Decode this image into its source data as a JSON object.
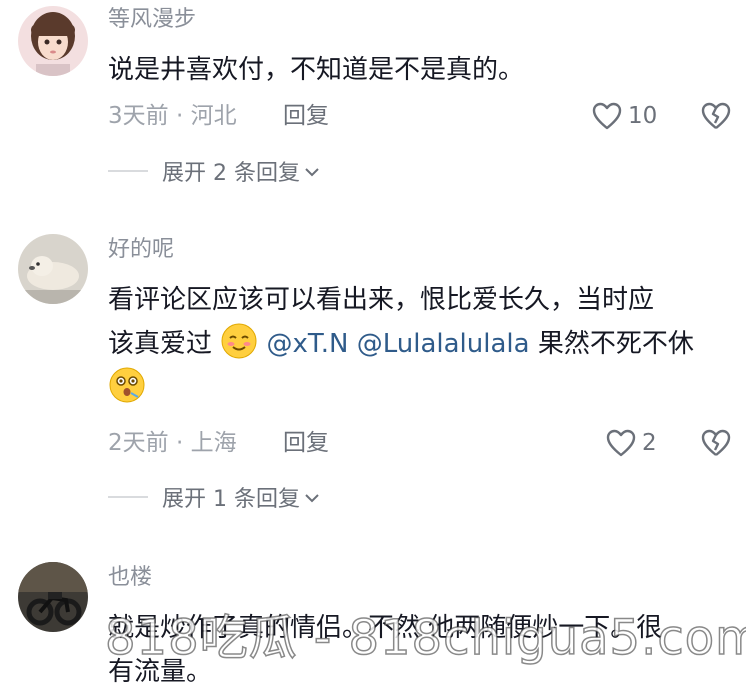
{
  "comments": [
    {
      "username": "等风漫步",
      "text": "说是井喜欢付，不知道是不是真的。",
      "time": "3天前 · 河北",
      "reply_label": "回复",
      "likes": "10",
      "expand_label": "展开 2 条回复"
    },
    {
      "username": "好的呢",
      "text_line1": "看评论区应该可以看出来，恨比爱长久，当时应",
      "text_line2_prefix": "该真爱过",
      "mention1": "@xT.N",
      "mention2": "@Lulalalulala",
      "text_line2_suffix": "果然不死不休",
      "time": "2天前 · 上海",
      "reply_label": "回复",
      "likes": "2",
      "expand_label": "展开 1 条回复"
    },
    {
      "username": "也楼",
      "text_line1": "就是炒作了真的情侣。不然 他两随便炒一下。很",
      "text_line2": "有流量。"
    }
  ],
  "watermark": "818吃瓜 - 818chigua5.com",
  "icons": {
    "like": "heart-icon",
    "dislike": "broken-heart-icon",
    "expand": "chevron-down-icon",
    "emoji1": "blush-emoji-icon",
    "emoji2": "dizzy-emoji-icon"
  },
  "colors": {
    "mention": "#2f5b8a",
    "meta": "#9ea3ab",
    "text": "#161823"
  }
}
